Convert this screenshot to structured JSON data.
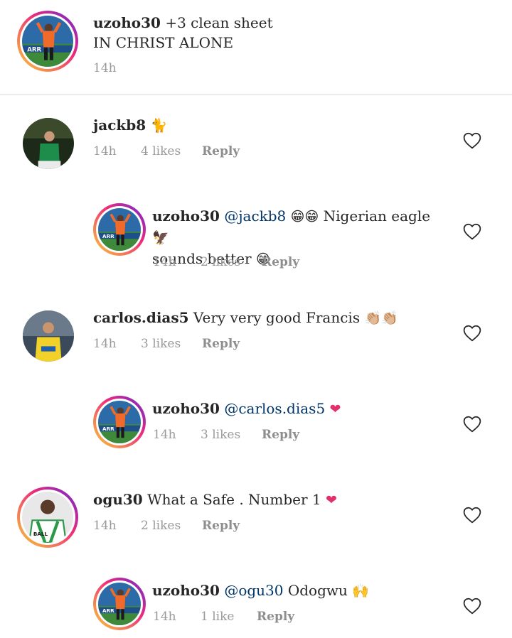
{
  "caption": {
    "username": "uzoho30",
    "line1": "+3 clean sheet",
    "line2": "IN CHRIST ALONE",
    "time": "14h"
  },
  "comments": [
    {
      "username": "jackb8",
      "text": "",
      "emoji": "🐈",
      "time": "14h",
      "likes": "4 likes",
      "reply": "Reply"
    },
    {
      "username": "uzoho30",
      "mention": "@jackb8",
      "emoji": "😁😁",
      "text": "Nigerian eagle",
      "emoji2": "🦅",
      "text2": "sounds better",
      "emoji3": "😁",
      "time": "14h",
      "likes": "2 likes",
      "reply": "Reply"
    },
    {
      "username": "carlos.dias5",
      "text": "Very very good Francis",
      "emoji": "👏🏼👏🏼",
      "time": "14h",
      "likes": "3 likes",
      "reply": "Reply"
    },
    {
      "username": "uzoho30",
      "mention": "@carlos.dias5",
      "emoji": "❤",
      "time": "14h",
      "likes": "3 likes",
      "reply": "Reply"
    },
    {
      "username": "ogu30",
      "text": "What a Safe . Number 1",
      "emoji": "❤",
      "time": "14h",
      "likes": "2 likes",
      "reply": "Reply"
    },
    {
      "username": "uzoho30",
      "mention": "@ogu30",
      "text": "Odogwu",
      "emoji": "🙌",
      "time": "14h",
      "likes": "1 like",
      "reply": "Reply"
    }
  ],
  "colors": {
    "ring_start": "#f9ce34",
    "ring_end": "#ee2a7b",
    "mention": "#003569",
    "heart": "#e1306c",
    "meta": "#9a9a9a"
  },
  "icons": {
    "like": "heart-outline-icon"
  }
}
